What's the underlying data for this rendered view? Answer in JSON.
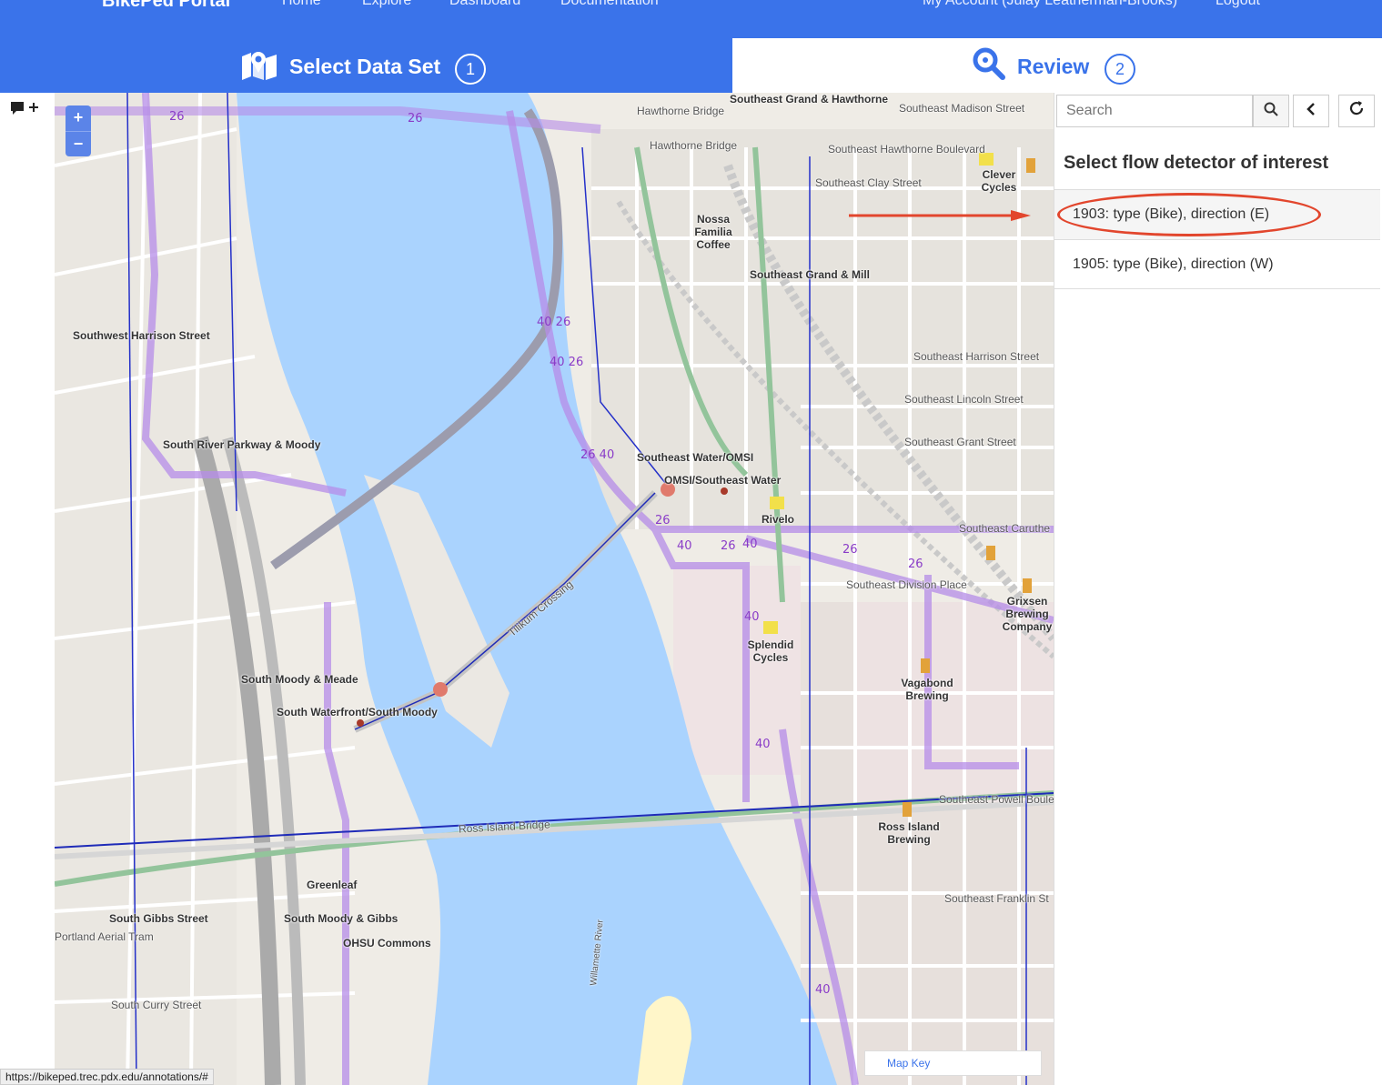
{
  "topnav": {
    "brand": "BikePed Portal",
    "links": [
      "Home",
      "Explore",
      "Dashboard",
      "Documentation"
    ],
    "account": "My Account (Julay Leatherman-Brooks)",
    "logout": "Logout"
  },
  "steps": {
    "step1": {
      "label": "Select Data Set",
      "num": "1"
    },
    "step2": {
      "label": "Review",
      "num": "2"
    }
  },
  "map": {
    "zoom_in": "+",
    "zoom_out": "−",
    "map_key": "Map Key",
    "labels": {
      "se_grand_hawthorne": "Southeast Grand & Hawthorne",
      "hawthorne_bridge_1": "Hawthorne Bridge",
      "hawthorne_bridge_2": "Hawthorne Bridge",
      "se_madison": "Southeast Madison Street",
      "se_hawthorne_blvd": "Southeast Hawthorne Boulevard",
      "se_clay": "Southeast Clay Street",
      "clever_cycles": "Clever Cycles",
      "nossa": "Nossa Familia Coffee",
      "se_grand_mill": "Southeast Grand & Mill",
      "sw_harrison": "Southwest Harrison Street",
      "se_harrison": "Southeast Harrison Street",
      "se_lincoln": "Southeast Lincoln Street",
      "se_grant": "Southeast Grant Street",
      "s_river_pkwy": "South River Parkway & Moody",
      "se_water_omsi": "Southeast Water/OMSI",
      "omsi_se_water": "OMSI/Southeast Water",
      "rivelo": "Rivelo",
      "se_division_place": "Southeast Division Place",
      "grixsen": "Grixsen Brewing Company",
      "splendid": "Splendid Cycles",
      "vagabond": "Vagabond Brewing",
      "s_moody_meade": "South Moody & Meade",
      "s_waterfront_moody": "South Waterfront/South Moody",
      "ross_island_bridge": "Ross Island Bridge",
      "ross_island_brewing": "Ross Island Brewing",
      "se_powell": "Southeast Powell Boulevard",
      "greenleaf": "Greenleaf",
      "s_gibbs": "South Gibbs Street",
      "s_moody_gibbs": "South Moody & Gibbs",
      "ohsu": "OHSU Commons",
      "portland_tram": "Portland Aerial Tram",
      "s_curry": "South Curry Street",
      "se_franklin": "Southeast Franklin St",
      "tilikum": "Tilikum Crossing",
      "willamette": "Willamette River",
      "se_caruthers": "Southeast Caruthe"
    }
  },
  "panel": {
    "search_placeholder": "Search",
    "title": "Select flow detector of interest",
    "detectors": [
      {
        "label": "1903: type (Bike), direction (E)"
      },
      {
        "label": "1905: type (Bike), direction (W)"
      }
    ]
  },
  "status_url": "https://bikeped.trec.pdx.edu/annotations/#",
  "colors": {
    "primary": "#3a73ea",
    "highlight": "#e2462d",
    "water": "#aad3fe",
    "bike_route": "#b58ce8"
  }
}
